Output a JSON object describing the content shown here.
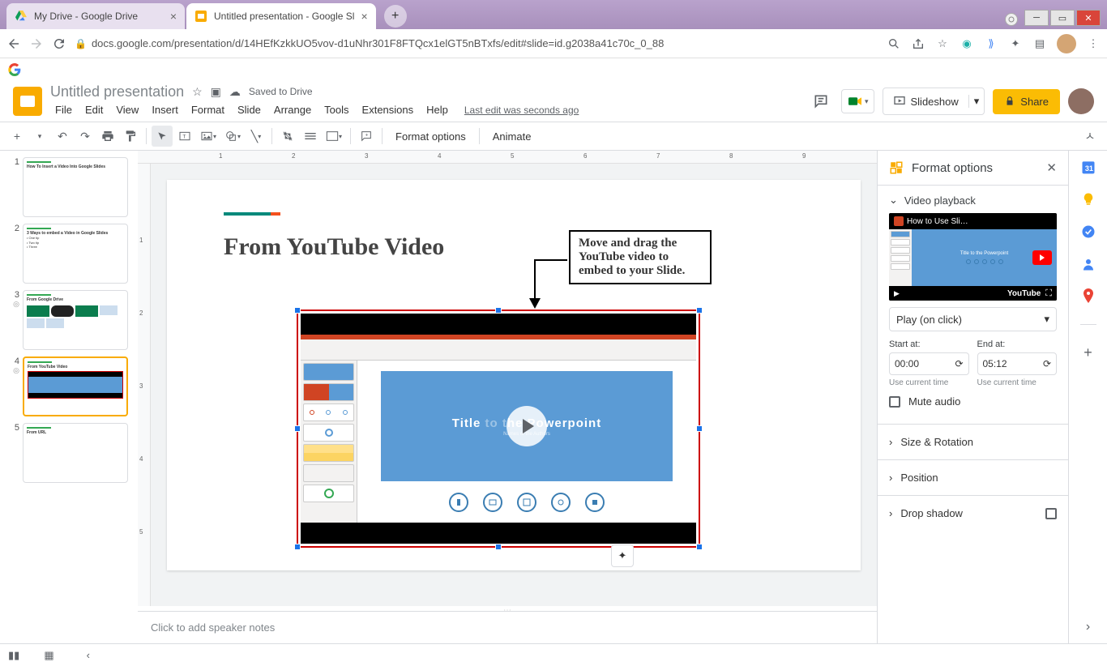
{
  "browser": {
    "tabs": [
      {
        "title": "My Drive - Google Drive",
        "favicon": "drive"
      },
      {
        "title": "Untitled presentation - Google Sl",
        "favicon": "slides"
      }
    ],
    "url": "docs.google.com/presentation/d/14HEfKzkkUO5vov-d1uNhr301F8FTQcx1elGT5nBTxfs/edit#slide=id.g2038a41c70c_0_88"
  },
  "doc": {
    "title": "Untitled presentation",
    "saved": "Saved to Drive",
    "last_edit": "Last edit was seconds ago"
  },
  "menus": [
    "File",
    "Edit",
    "View",
    "Insert",
    "Format",
    "Slide",
    "Arrange",
    "Tools",
    "Extensions",
    "Help"
  ],
  "header_buttons": {
    "slideshow": "Slideshow",
    "share": "Share"
  },
  "toolbar": {
    "format_options": "Format options",
    "animate": "Animate"
  },
  "thumbs": [
    {
      "num": "1",
      "title": "How To Insert a Video Into Google Slides"
    },
    {
      "num": "2",
      "title": "3 Ways to embed a Video in Google Slides"
    },
    {
      "num": "3",
      "title": "From Google Drive",
      "clip": true
    },
    {
      "num": "4",
      "title": "From YouTube Video",
      "clip": true,
      "selected": true
    },
    {
      "num": "5",
      "title": "From URL"
    }
  ],
  "slide": {
    "title": "From YouTube Video",
    "annotation": "Move and drag the YouTube video to embed to your Slide.",
    "video": {
      "title": "Title to the Powerpoint",
      "subtitle": "Names of the Authors"
    }
  },
  "notes_placeholder": "Click to add speaker notes",
  "format_panel": {
    "title": "Format options",
    "section": "Video playback",
    "preview_title": "How to Use Sli…",
    "preview_slide_title": "Title to the Powerpoint",
    "yt_label": "YouTube",
    "play_mode": "Play (on click)",
    "start_label": "Start at:",
    "end_label": "End at:",
    "start_time": "00:00",
    "end_time": "05:12",
    "use_current": "Use current time",
    "mute": "Mute audio",
    "size_rotation": "Size & Rotation",
    "position": "Position",
    "drop_shadow": "Drop shadow"
  }
}
